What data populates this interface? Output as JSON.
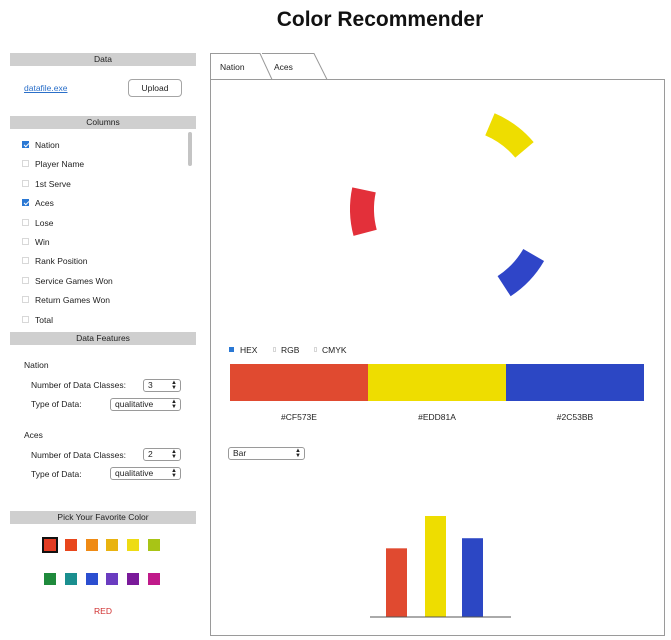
{
  "app": {
    "title": "Color Recommender"
  },
  "data_section": {
    "header": "Data",
    "file_link": "datafile.exe",
    "upload_label": "Upload"
  },
  "columns_section": {
    "header": "Columns",
    "items": [
      {
        "label": "Nation",
        "checked": true
      },
      {
        "label": "Player Name",
        "checked": false
      },
      {
        "label": "1st Serve",
        "checked": false
      },
      {
        "label": "Aces",
        "checked": true
      },
      {
        "label": "Lose",
        "checked": false
      },
      {
        "label": "Win",
        "checked": false
      },
      {
        "label": "Rank Position",
        "checked": false
      },
      {
        "label": "Service Games Won",
        "checked": false
      },
      {
        "label": "Return Games Won",
        "checked": false
      },
      {
        "label": "Total",
        "checked": false
      }
    ]
  },
  "features_section": {
    "header": "Data Features",
    "groups": [
      {
        "name": "Nation",
        "classes_label": "Number of Data Classes:",
        "classes_value": "3",
        "type_label": "Type of Data:",
        "type_value": "qualitative"
      },
      {
        "name": "Aces",
        "classes_label": "Number of Data Classes:",
        "classes_value": "2",
        "type_label": "Type of Data:",
        "type_value": "qualitative"
      }
    ]
  },
  "favorite_section": {
    "header": "Pick Your Favorite Color",
    "swatches_row1": [
      "#e23c23",
      "#e8461c",
      "#ef8a14",
      "#e9b310",
      "#eedc14",
      "#a8c416"
    ],
    "swatches_row2": [
      "#1f8a3c",
      "#1a8f8f",
      "#2b4ed0",
      "#6a3cc0",
      "#7a1a9a",
      "#c01a8a"
    ],
    "selected_index": 0,
    "selected_name": "RED"
  },
  "tabs": [
    {
      "label": "Nation",
      "active": true
    },
    {
      "label": "Aces",
      "active": false
    }
  ],
  "arcs": [
    {
      "name": "red-arc",
      "color": "#e3303a"
    },
    {
      "name": "yellow-arc",
      "color": "#eedd00"
    },
    {
      "name": "blue-arc",
      "color": "#2f45c8"
    }
  ],
  "format": {
    "options": [
      {
        "label": "HEX",
        "selected": true
      },
      {
        "label": "RGB",
        "selected": false
      },
      {
        "label": "CMYK",
        "selected": false
      }
    ]
  },
  "palette": [
    {
      "hex": "#CF573E",
      "color": "#e04a30"
    },
    {
      "hex": "#EDD81A",
      "color": "#eedd00"
    },
    {
      "hex": "#2C53BB",
      "color": "#2c47c4"
    }
  ],
  "chart_select": {
    "value": "Bar"
  },
  "chart_data": {
    "type": "bar",
    "categories": [
      "",
      "",
      ""
    ],
    "values": [
      0.68,
      1.0,
      0.78
    ],
    "colors": [
      "#e04a30",
      "#eedd00",
      "#2c47c4"
    ],
    "title": "",
    "xlabel": "",
    "ylabel": ""
  }
}
